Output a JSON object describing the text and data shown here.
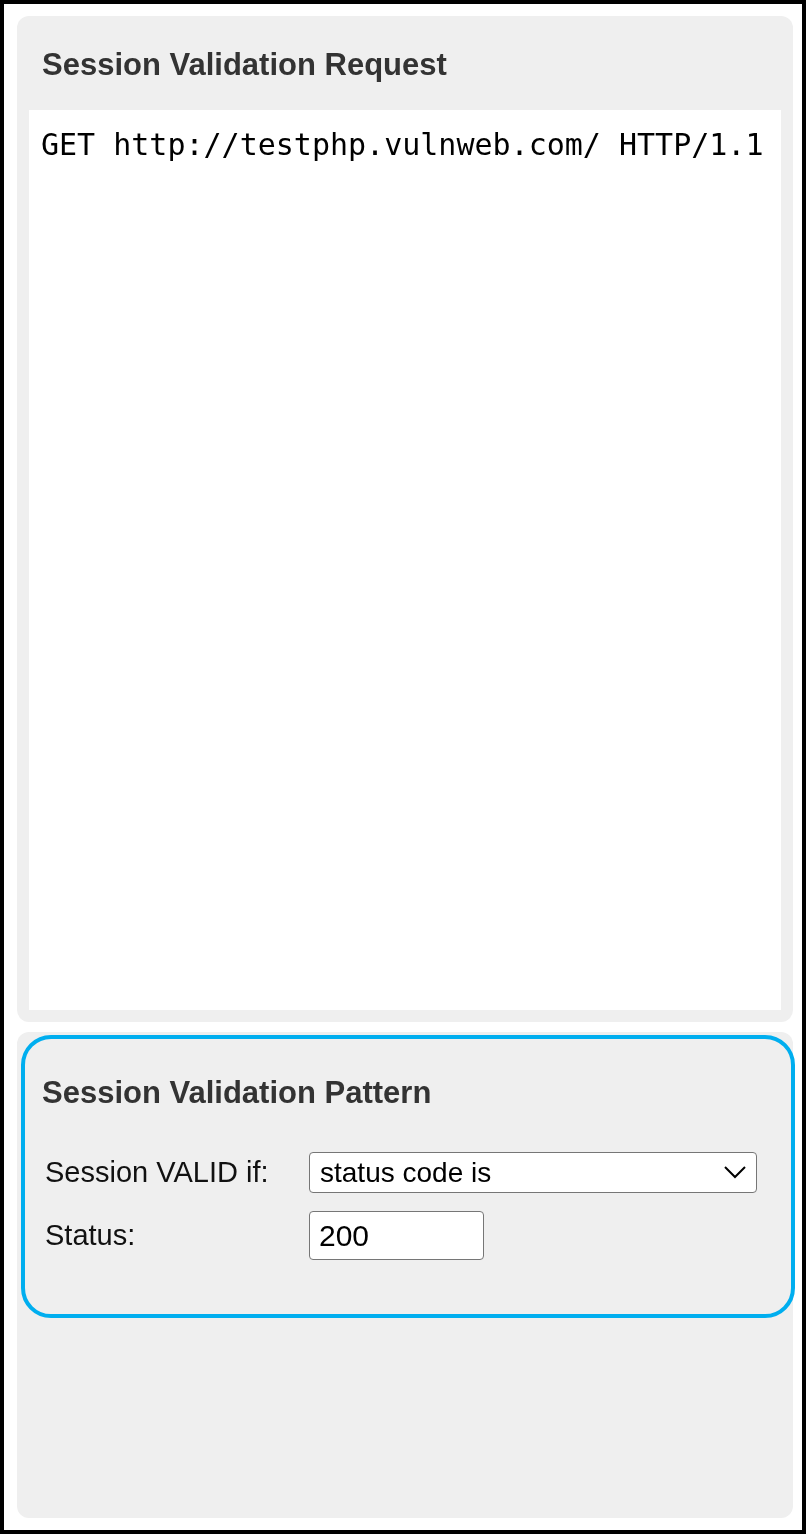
{
  "request_panel": {
    "title": "Session Validation Request",
    "request_text": "GET http://testphp.vulnweb.com/ HTTP/1.1"
  },
  "pattern_panel": {
    "title": "Session Validation Pattern",
    "highlighted": true,
    "fields": [
      {
        "kind": "select",
        "label": "Session VALID if:",
        "value": "status code is"
      },
      {
        "kind": "text",
        "label": "Status:",
        "value": "200"
      }
    ]
  }
}
